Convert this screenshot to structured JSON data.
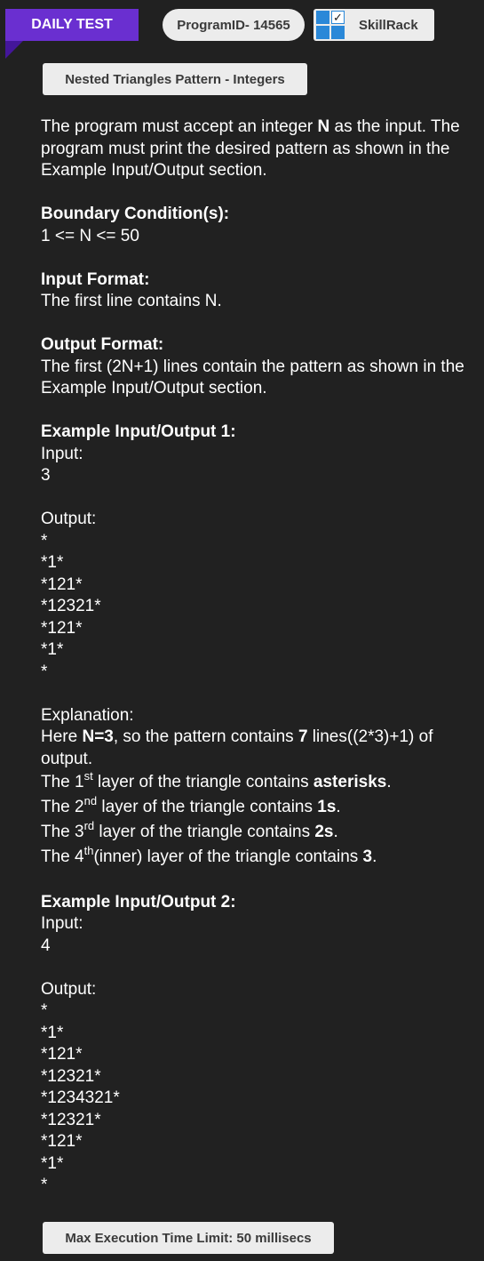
{
  "header": {
    "ribbon_label": "DAILY TEST",
    "program_id": "ProgramID- 14565",
    "brand_label": "SkillRack",
    "brand_logo_icon": "skillrack-logo-icon",
    "brand_check_glyph": "✓"
  },
  "problem": {
    "title": "Nested Triangles Pattern - Integers",
    "description": {
      "p1": "The program must accept an integer ",
      "n": "N",
      "p2": " as the input. The program must print the desired pattern as shown in the Example Input/Output section."
    },
    "boundary": {
      "heading": "Boundary Condition(s):",
      "text": "1 <= N <= 50"
    },
    "input_format": {
      "heading": "Input Format:",
      "text": "The first line contains N."
    },
    "output_format": {
      "heading": "Output Format:",
      "text": "The first (2N+1) lines contain the pattern as shown in the Example Input/Output section."
    },
    "example1": {
      "heading": "Example Input/Output 1:",
      "input_label": "Input:",
      "input_value": "3",
      "output_label": "Output:",
      "output_lines": [
        "*",
        "*1*",
        "*121*",
        "*12321*",
        "*121*",
        "*1*",
        "*"
      ],
      "explanation_label": "Explanation:",
      "exp_line1": {
        "a": "Here ",
        "b": "N=3",
        "c": ", so the pattern contains ",
        "d": "7",
        "e": " lines((2*3)+1) of output."
      },
      "layers": [
        {
          "pre": "The 1",
          "sup": "st",
          "mid": " layer of the triangle contains ",
          "bold": "asterisks",
          "post": "."
        },
        {
          "pre": "The 2",
          "sup": "nd",
          "mid": " layer of the triangle contains ",
          "bold": "1s",
          "post": "."
        },
        {
          "pre": "The 3",
          "sup": "rd",
          "mid": " layer of the triangle contains ",
          "bold": "2s",
          "post": "."
        },
        {
          "pre": "The 4",
          "sup": "th",
          "mid": "(inner) layer of the triangle contains ",
          "bold": "3",
          "post": "."
        }
      ]
    },
    "example2": {
      "heading": "Example Input/Output 2:",
      "input_label": "Input:",
      "input_value": "4",
      "output_label": "Output:",
      "output_lines": [
        "*",
        "*1*",
        "*121*",
        "*12321*",
        "*1234321*",
        "*12321*",
        "*121*",
        "*1*",
        "*"
      ]
    }
  },
  "footer": {
    "time_limit": "Max Execution Time Limit: 50 millisecs"
  },
  "colors": {
    "background": "#212121",
    "ribbon": "#6a2fd0",
    "tag_bg": "#ececec",
    "logo_blue": "#2a88d8"
  }
}
